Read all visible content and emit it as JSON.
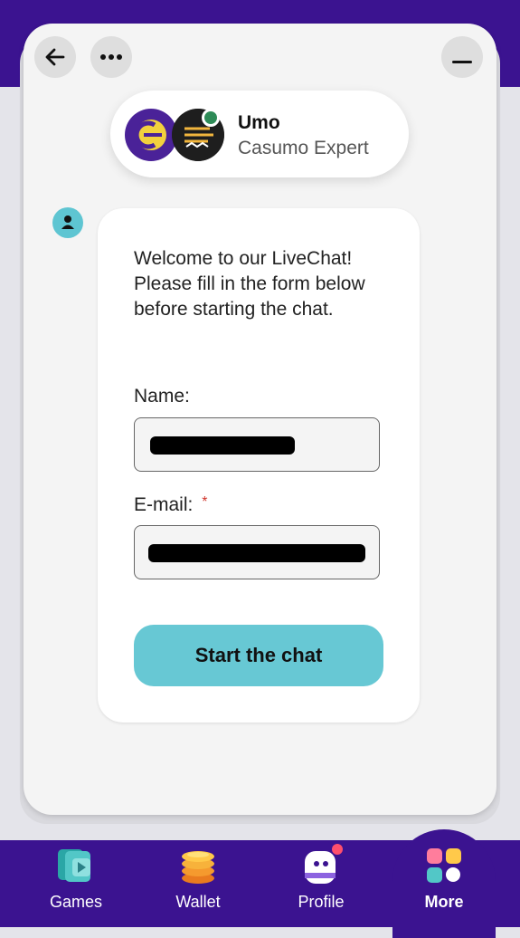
{
  "header": {
    "back_icon": "arrow-left-icon",
    "more_icon": "ellipsis-icon",
    "minimize_icon": "minimize-icon"
  },
  "agent": {
    "name": "Umo",
    "role": "Casumo Expert",
    "status_color": "#2e8b57"
  },
  "form": {
    "welcome_text": "Welcome to our LiveChat! Please fill in the form below before starting the chat.",
    "name_label": "Name:",
    "email_label": "E-mail:",
    "required_marker": "*",
    "submit_label": "Start the chat"
  },
  "bottom_nav": {
    "items": [
      {
        "label": "Games",
        "icon": "games-icon"
      },
      {
        "label": "Wallet",
        "icon": "coins-icon"
      },
      {
        "label": "Profile",
        "icon": "profile-icon"
      },
      {
        "label": "More",
        "icon": "grid-icon"
      }
    ],
    "active": "More"
  },
  "colors": {
    "brand_purple": "#3b1390",
    "accent_teal": "#67c8d4",
    "required_red": "#d0342c",
    "notification_dot": "#ff4f6d"
  }
}
